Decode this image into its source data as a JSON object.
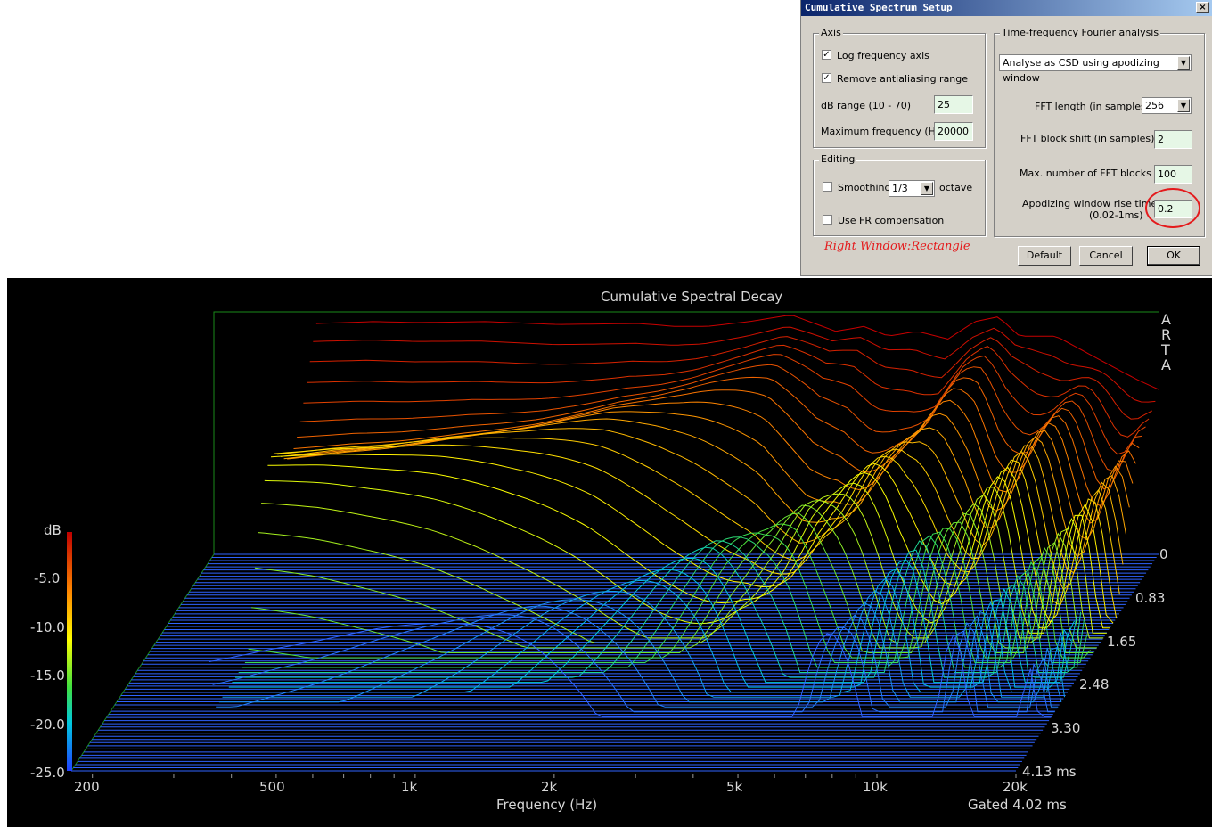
{
  "dialog": {
    "title": "Cumulative Spectrum Setup",
    "close_glyph": "×",
    "axis_group": {
      "legend": "Axis",
      "log_frequency": {
        "label": "Log frequency axis",
        "checked": true
      },
      "remove_antialiasing": {
        "label": "Remove antialiasing range",
        "checked": true
      },
      "db_range_label": "dB range (10 - 70)",
      "db_range_value": "25",
      "max_freq_label": "Maximum frequency (Hz)",
      "max_freq_value": "20000"
    },
    "editing_group": {
      "legend": "Editing",
      "smoothing": {
        "label": "Smoothing",
        "checked": false,
        "value": "1/3",
        "suffix": "octave"
      },
      "fr_compensation": {
        "label": "Use FR compensation",
        "checked": false
      }
    },
    "tf_group": {
      "legend": "Time-frequency Fourier analysis",
      "mode": "Analyse as CSD using apodizing window",
      "fft_length_label": "FFT length (in samples)",
      "fft_length_value": "256",
      "fft_shift_label": "FFT block shift (in samples)",
      "fft_shift_value": "2",
      "max_blocks_label": "Max. number of FFT blocks",
      "max_blocks_value": "100",
      "rise_time_label1": "Apodizing window rise time",
      "rise_time_label2": "(0.02-1ms)",
      "rise_time_value": "0.2"
    },
    "note": "Right Window:Rectangle",
    "buttons": {
      "default": "Default",
      "cancel": "Cancel",
      "ok": "OK"
    },
    "check_glyph": "✓",
    "arrow_glyph": "▼"
  },
  "plot": {
    "title": "Cumulative Spectral Decay",
    "watermark": [
      "A",
      "R",
      "T",
      "A"
    ],
    "colorbar_title": "dB",
    "db_ticks": [
      "-5.0",
      "-10.0",
      "-15.0",
      "-20.0",
      "-25.0"
    ],
    "freq_ticks": [
      "200",
      "500",
      "1k",
      "2k",
      "5k",
      "10k",
      "20k"
    ],
    "time_ticks": [
      "0",
      "0.83",
      "1.65",
      "2.48",
      "3.30",
      "4.13 ms"
    ],
    "x_label": "Frequency (Hz)",
    "gated_label": "Gated 4.02 ms",
    "colors": {
      "background": "#000000",
      "frame": "#1a8a1a",
      "baseline": "#2f63ff"
    },
    "chart_data": {
      "type": "waterfall",
      "title": "Cumulative Spectral Decay",
      "xlabel": "Frequency (Hz)",
      "xscale": "log",
      "xlim": [
        180,
        20000
      ],
      "ylabel": "dB",
      "zlim": [
        -25,
        0
      ],
      "time_range_ms": [
        0,
        4.13
      ],
      "slice_count": 70,
      "first_slice": {
        "freq_hz": [
          300,
          400,
          500,
          700,
          1000,
          1500,
          1800,
          2100,
          2600,
          3200,
          4000,
          4600,
          5200,
          6000,
          7000,
          8000,
          9000,
          10000,
          12000,
          15000,
          18000,
          20000
        ],
        "db": [
          -1.2,
          -1.0,
          -1.1,
          -1.0,
          -1.3,
          -1.2,
          -1.5,
          -1.5,
          -1.0,
          -0.3,
          -2.0,
          -1.5,
          -2.5,
          -2.0,
          -2.8,
          -1.0,
          -0.5,
          -2.5,
          -2.5,
          -5.0,
          -7.0,
          -8.0
        ]
      }
    }
  }
}
